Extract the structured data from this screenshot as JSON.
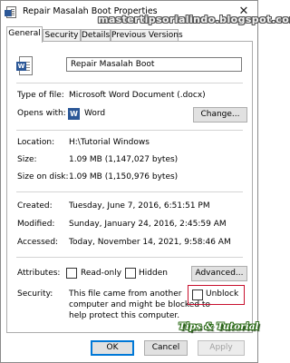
{
  "window": {
    "title": "Repair Masalah Boot Properties",
    "watermark": "mastertipsorialindo.blogspot.com",
    "close_symbol": "✕"
  },
  "tabs": [
    {
      "label": "General",
      "active": true
    },
    {
      "label": "Security"
    },
    {
      "label": "Details"
    },
    {
      "label": "Previous Versions"
    }
  ],
  "file": {
    "name": "Repair Masalah Boot",
    "icon": "word-document-icon"
  },
  "properties": {
    "type_label": "Type of file:",
    "type_value": "Microsoft Word Document (.docx)",
    "opens_label": "Opens with:",
    "opens_value": "Word",
    "opens_icon_letter": "W",
    "change_button": "Change...",
    "location_label": "Location:",
    "location_value": "H:\\Tutorial Windows",
    "size_label": "Size:",
    "size_value": "1.09 MB (1,147,027 bytes)",
    "size_disk_label": "Size on disk:",
    "size_disk_value": "1.09 MB (1,150,976 bytes)",
    "created_label": "Created:",
    "created_value": "Tuesday, June 7, 2016, 6:51:51 PM",
    "modified_label": "Modified:",
    "modified_value": "Sunday, January 24, 2016, 2:45:59 AM",
    "accessed_label": "Accessed:",
    "accessed_value": "Today, November 14, 2021, 9:58:46 AM"
  },
  "attributes": {
    "label": "Attributes:",
    "readonly": "Read-only",
    "hidden": "Hidden",
    "advanced_button": "Advanced..."
  },
  "security": {
    "label": "Security:",
    "line1": "This file came from another",
    "line2": "computer and might be blocked to",
    "line3": "help protect this computer.",
    "unblock": "Unblock",
    "highlight_color": "#c8102e"
  },
  "overlay": {
    "tips_text": "Tips & Tutorial"
  },
  "buttons": {
    "ok": "OK",
    "cancel": "Cancel",
    "apply": "Apply"
  }
}
